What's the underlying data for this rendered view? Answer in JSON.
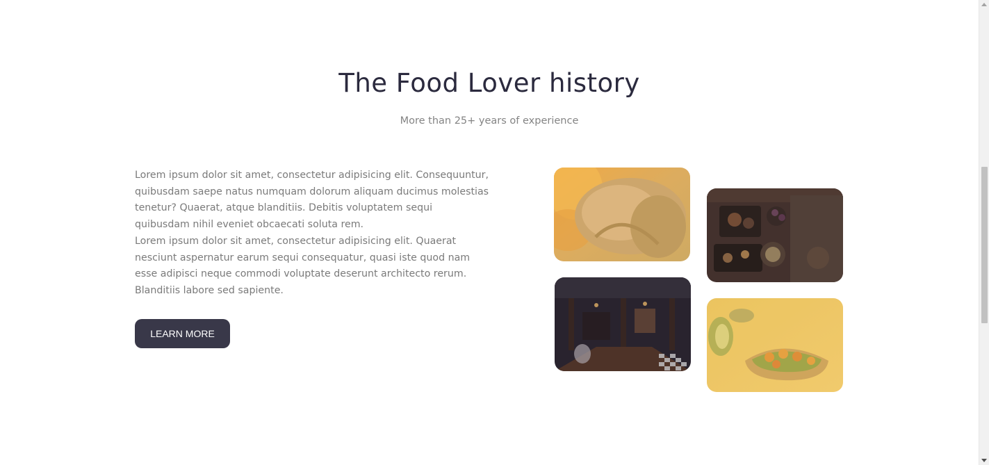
{
  "section": {
    "title": "The Food Lover history",
    "subtitle": "More than 25+ years of experience",
    "paragraphs": [
      "Lorem ipsum dolor sit amet, consectetur adipisicing elit. Consequuntur, quibusdam saepe natus numquam dolorum aliquam ducimus molestias tenetur? Quaerat, atque blanditiis. Debitis voluptatem sequi quibusdam nihil eveniet obcaecati soluta rem.",
      "Lorem ipsum dolor sit amet, consectetur adipisicing elit. Quaerat nesciunt aspernatur earum sequi consequatur, quasi iste quod nam esse adipisci neque commodi voluptate deserunt architecto rerum. Blanditiis labore sed sapiente."
    ],
    "button_label": "LEARN MORE"
  },
  "gallery": {
    "images": [
      {
        "name": "roast-meat-image"
      },
      {
        "name": "dinner-table-image"
      },
      {
        "name": "restaurant-interior-image"
      },
      {
        "name": "avocado-toast-image"
      }
    ]
  },
  "colors": {
    "heading": "#2b2a3e",
    "subtitle": "#848484",
    "body": "#7a7a7a",
    "button_bg": "#393849",
    "button_text": "#ffffff"
  }
}
